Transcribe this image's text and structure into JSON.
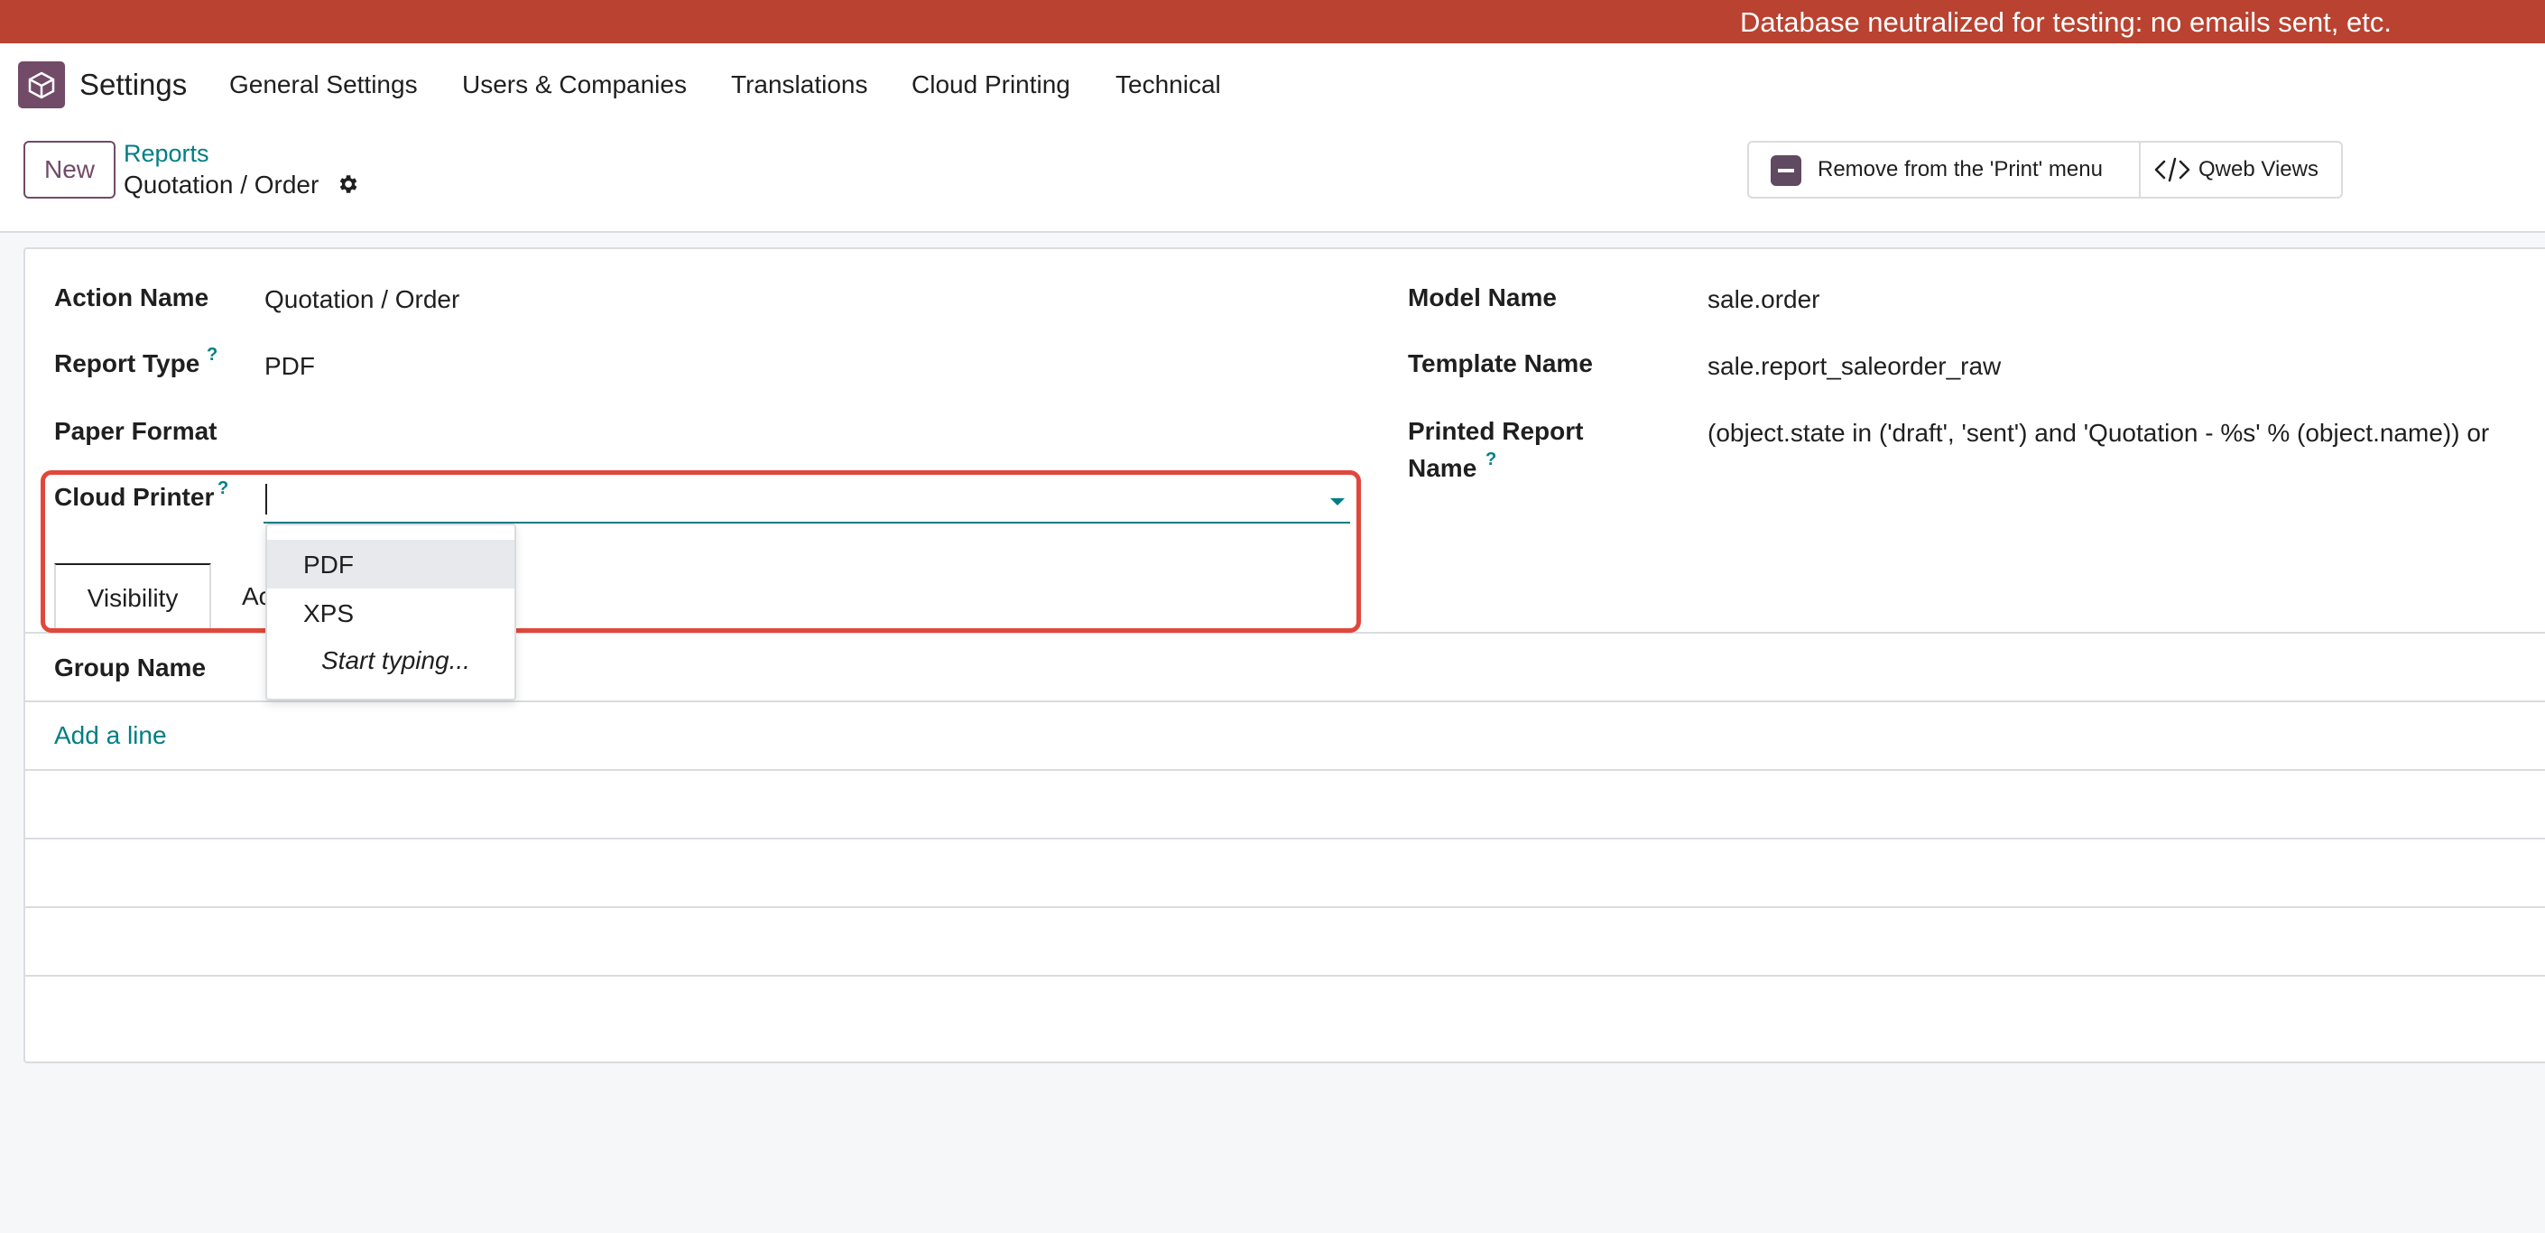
{
  "banner": {
    "text": "Database neutralized for testing: no emails sent, etc."
  },
  "navbar": {
    "brand": "Settings",
    "items": [
      {
        "label": "General Settings"
      },
      {
        "label": "Users & Companies"
      },
      {
        "label": "Translations"
      },
      {
        "label": "Cloud Printing"
      },
      {
        "label": "Technical"
      }
    ]
  },
  "control": {
    "new_label": "New",
    "breadcrumb_parent": "Reports",
    "breadcrumb_current": "Quotation / Order",
    "remove_label": "Remove from the 'Print' menu",
    "qweb_label": "Qweb Views"
  },
  "form": {
    "left": {
      "action_name_label": "Action Name",
      "action_name_value": "Quotation / Order",
      "report_type_label": "Report Type",
      "report_type_value": "PDF",
      "paper_format_label": "Paper Format",
      "cloud_printer_label": "Cloud Printer"
    },
    "right": {
      "model_name_label": "Model Name",
      "model_name_value": "sale.order",
      "template_name_label": "Template Name",
      "template_name_value": "sale.report_saleorder_raw",
      "printed_name_label_1": "Printed Report",
      "printed_name_label_2": "Name",
      "printed_name_value": "(object.state in ('draft', 'sent') and 'Quotation - %s' % (object.name)) or"
    },
    "help_mark": "?"
  },
  "tabs": [
    {
      "label": "Visibility"
    },
    {
      "label": "Ac"
    }
  ],
  "table": {
    "group_name_header": "Group Name",
    "add_line": "Add a line"
  },
  "dropdown": {
    "options": [
      "PDF",
      "XPS"
    ],
    "hint": "Start typing..."
  },
  "colors": {
    "banner": "#b94230",
    "brand": "#714b67",
    "link": "#017e84",
    "highlight": "#e1473b"
  }
}
